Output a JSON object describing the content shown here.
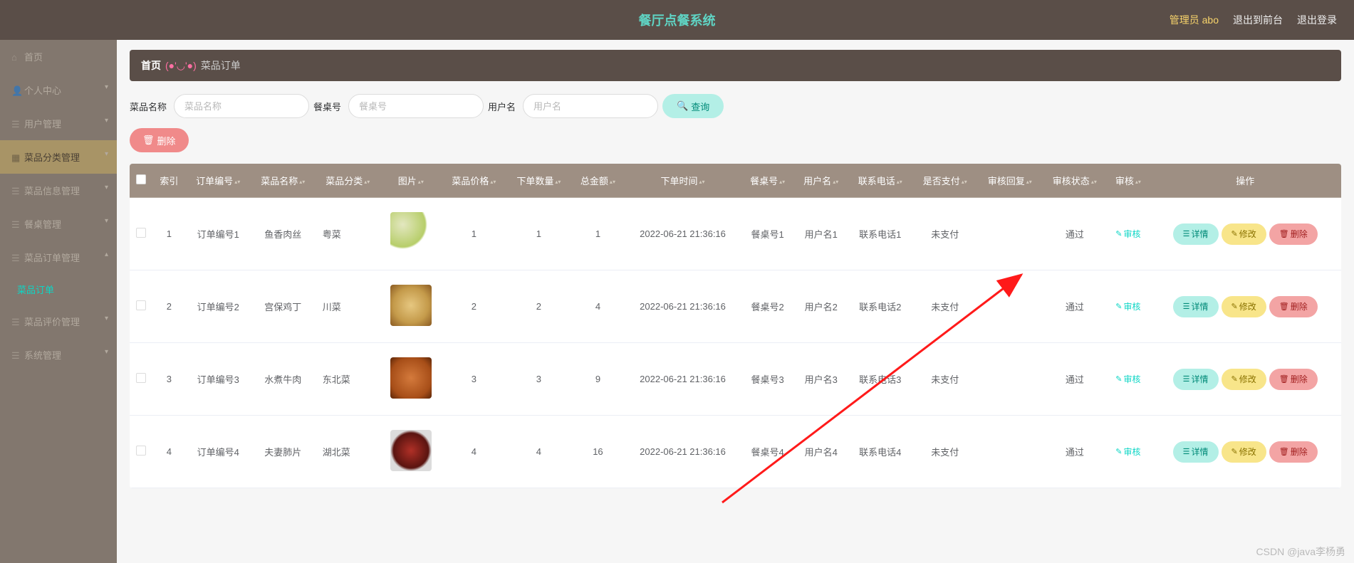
{
  "header": {
    "title": "餐厅点餐系统",
    "admin_label": "管理员 abo",
    "to_front_label": "退出到前台",
    "logout_label": "退出登录"
  },
  "sidebar": {
    "items": [
      {
        "label": "首页"
      },
      {
        "label": "个人中心"
      },
      {
        "label": "用户管理"
      },
      {
        "label": "菜品分类管理"
      },
      {
        "label": "菜品信息管理"
      },
      {
        "label": "餐桌管理"
      },
      {
        "label": "菜品订单管理",
        "sub": {
          "label": "菜品订单"
        }
      },
      {
        "label": "菜品评价管理"
      },
      {
        "label": "系统管理"
      }
    ]
  },
  "breadcrumb": {
    "home": "首页",
    "emoji": "(●'◡'●)",
    "current": "菜品订单"
  },
  "search": {
    "name_label": "菜品名称",
    "name_placeholder": "菜品名称",
    "table_label": "餐桌号",
    "table_placeholder": "餐桌号",
    "user_label": "用户名",
    "user_placeholder": "用户名",
    "btn_label": "查询"
  },
  "bulk_delete_label": "删除",
  "table": {
    "headers": {
      "index": "索引",
      "order_no": "订单编号",
      "dish_name": "菜品名称",
      "dish_cat": "菜品分类",
      "image": "图片",
      "price": "菜品价格",
      "qty": "下单数量",
      "total": "总金额",
      "order_time": "下单时间",
      "table_no": "餐桌号",
      "user": "用户名",
      "phone": "联系电话",
      "paid": "是否支付",
      "reply": "审核回复",
      "status": "审核状态",
      "audit": "审核",
      "ops": "操作"
    },
    "rows": [
      {
        "idx": "1",
        "order_no": "订单编号1",
        "dish_name": "鱼香肉丝",
        "dish_cat": "粤菜",
        "price": "1",
        "qty": "1",
        "total": "1",
        "order_time": "2022-06-21 21:36:16",
        "table_no": "餐桌号1",
        "user": "用户名1",
        "phone": "联系电话1",
        "paid": "未支付",
        "reply": "",
        "status": "通过",
        "img": "d1"
      },
      {
        "idx": "2",
        "order_no": "订单编号2",
        "dish_name": "宫保鸡丁",
        "dish_cat": "川菜",
        "price": "2",
        "qty": "2",
        "total": "4",
        "order_time": "2022-06-21 21:36:16",
        "table_no": "餐桌号2",
        "user": "用户名2",
        "phone": "联系电话2",
        "paid": "未支付",
        "reply": "",
        "status": "通过",
        "img": "d2"
      },
      {
        "idx": "3",
        "order_no": "订单编号3",
        "dish_name": "水煮牛肉",
        "dish_cat": "东北菜",
        "price": "3",
        "qty": "3",
        "total": "9",
        "order_time": "2022-06-21 21:36:16",
        "table_no": "餐桌号3",
        "user": "用户名3",
        "phone": "联系电话3",
        "paid": "未支付",
        "reply": "",
        "status": "通过",
        "img": "d3"
      },
      {
        "idx": "4",
        "order_no": "订单编号4",
        "dish_name": "夫妻肺片",
        "dish_cat": "湖北菜",
        "price": "4",
        "qty": "4",
        "total": "16",
        "order_time": "2022-06-21 21:36:16",
        "table_no": "餐桌号4",
        "user": "用户名4",
        "phone": "联系电话4",
        "paid": "未支付",
        "reply": "",
        "status": "通过",
        "img": "d4"
      }
    ],
    "audit_link": "审核",
    "detail_btn": "详情",
    "edit_btn": "修改",
    "del_btn": "删除"
  },
  "watermark": "CSDN @java李杨勇"
}
